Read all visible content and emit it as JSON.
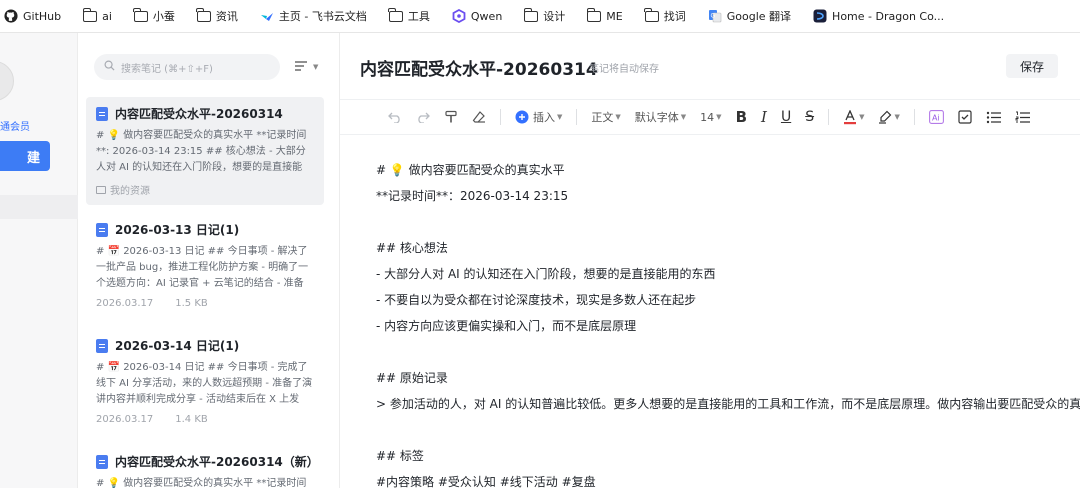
{
  "bookmarks": [
    {
      "label": "GitHub",
      "icon": "github-icon"
    },
    {
      "label": "ai",
      "icon": "folder-icon"
    },
    {
      "label": "小蚕",
      "icon": "folder-icon"
    },
    {
      "label": "资讯",
      "icon": "folder-icon"
    },
    {
      "label": "主页 - 飞书云文档",
      "icon": "feishu-icon"
    },
    {
      "label": "工具",
      "icon": "folder-icon"
    },
    {
      "label": "Qwen",
      "icon": "qwen-icon"
    },
    {
      "label": "设计",
      "icon": "folder-icon"
    },
    {
      "label": "ME",
      "icon": "folder-icon"
    },
    {
      "label": "找词",
      "icon": "folder-icon"
    },
    {
      "label": "Google 翻译",
      "icon": "google-translate-icon"
    },
    {
      "label": "Home - Dragon Co...",
      "icon": "dragon-icon"
    }
  ],
  "sidebar": {
    "member_label": "通会员",
    "new_button": "建"
  },
  "notes_list": {
    "search_placeholder": "搜索笔记 (⌘+⇧+F)",
    "items": [
      {
        "title": "内容匹配受众水平-20260314",
        "snippet": "# 💡 做内容要匹配受众的真实水平 **记录时间**: 2026-03-14 23:15 ## 核心想法 - 大部分人对 AI 的认知还在入门阶段，想要的是直接能用...",
        "date": "",
        "size": "",
        "folder": "我的资源",
        "active": true
      },
      {
        "title": "2026-03-13 日记(1)",
        "snippet": "# 📅 2026-03-13 日记 ## 今日事项 - 解决了一批产品 bug，推进工程化防护方案 - 明确了一个选题方向：AI 记录官 + 云笔记的结合 - 准备明...",
        "date": "2026.03.17",
        "size": "1.5 KB",
        "folder": "",
        "active": false
      },
      {
        "title": "2026-03-14 日记(1)",
        "snippet": "# 📅 2026-03-14 日记 ## 今日事项 - 完成了线下 AI 分享活动，来的人数远超预期 - 准备了演讲内容并顺利完成分享 - 活动结束后在 X 上发了...",
        "date": "2026.03.17",
        "size": "1.4 KB",
        "folder": "",
        "active": false
      },
      {
        "title": "内容匹配受众水平-20260314（新）",
        "snippet": "# 💡 做内容要匹配受众的真实水平 **记录时间",
        "date": "",
        "size": "",
        "folder": "",
        "active": false
      }
    ]
  },
  "editor": {
    "title": "内容匹配受众水平-20260314",
    "autosave_hint": "笔记将自动保存",
    "save_button": "保存",
    "toolbar": {
      "insert": "插入",
      "paragraph_style": "正文",
      "font": "默认字体",
      "font_size": "14"
    },
    "lines": [
      "# 💡 做内容要匹配受众的真实水平",
      "**记录时间**：2026-03-14 23:15",
      "",
      "## 核心想法",
      "- 大部分人对 AI 的认知还在入门阶段，想要的是直接能用的东西",
      "- 不要自以为受众都在讨论深度技术，现实是多数人还在起步",
      "- 内容方向应该更偏实操和入门，而不是底层原理",
      "",
      "## 原始记录",
      "> 参加活动的人，对 AI 的认知普遍比较低。更多人想要的是直接能用的工具和工作流，而不是底层原理。做内容输出要匹配受众的真实水平",
      "",
      "## 标签",
      "#内容策略 #受众认知 #线下活动 #复盘"
    ]
  }
}
